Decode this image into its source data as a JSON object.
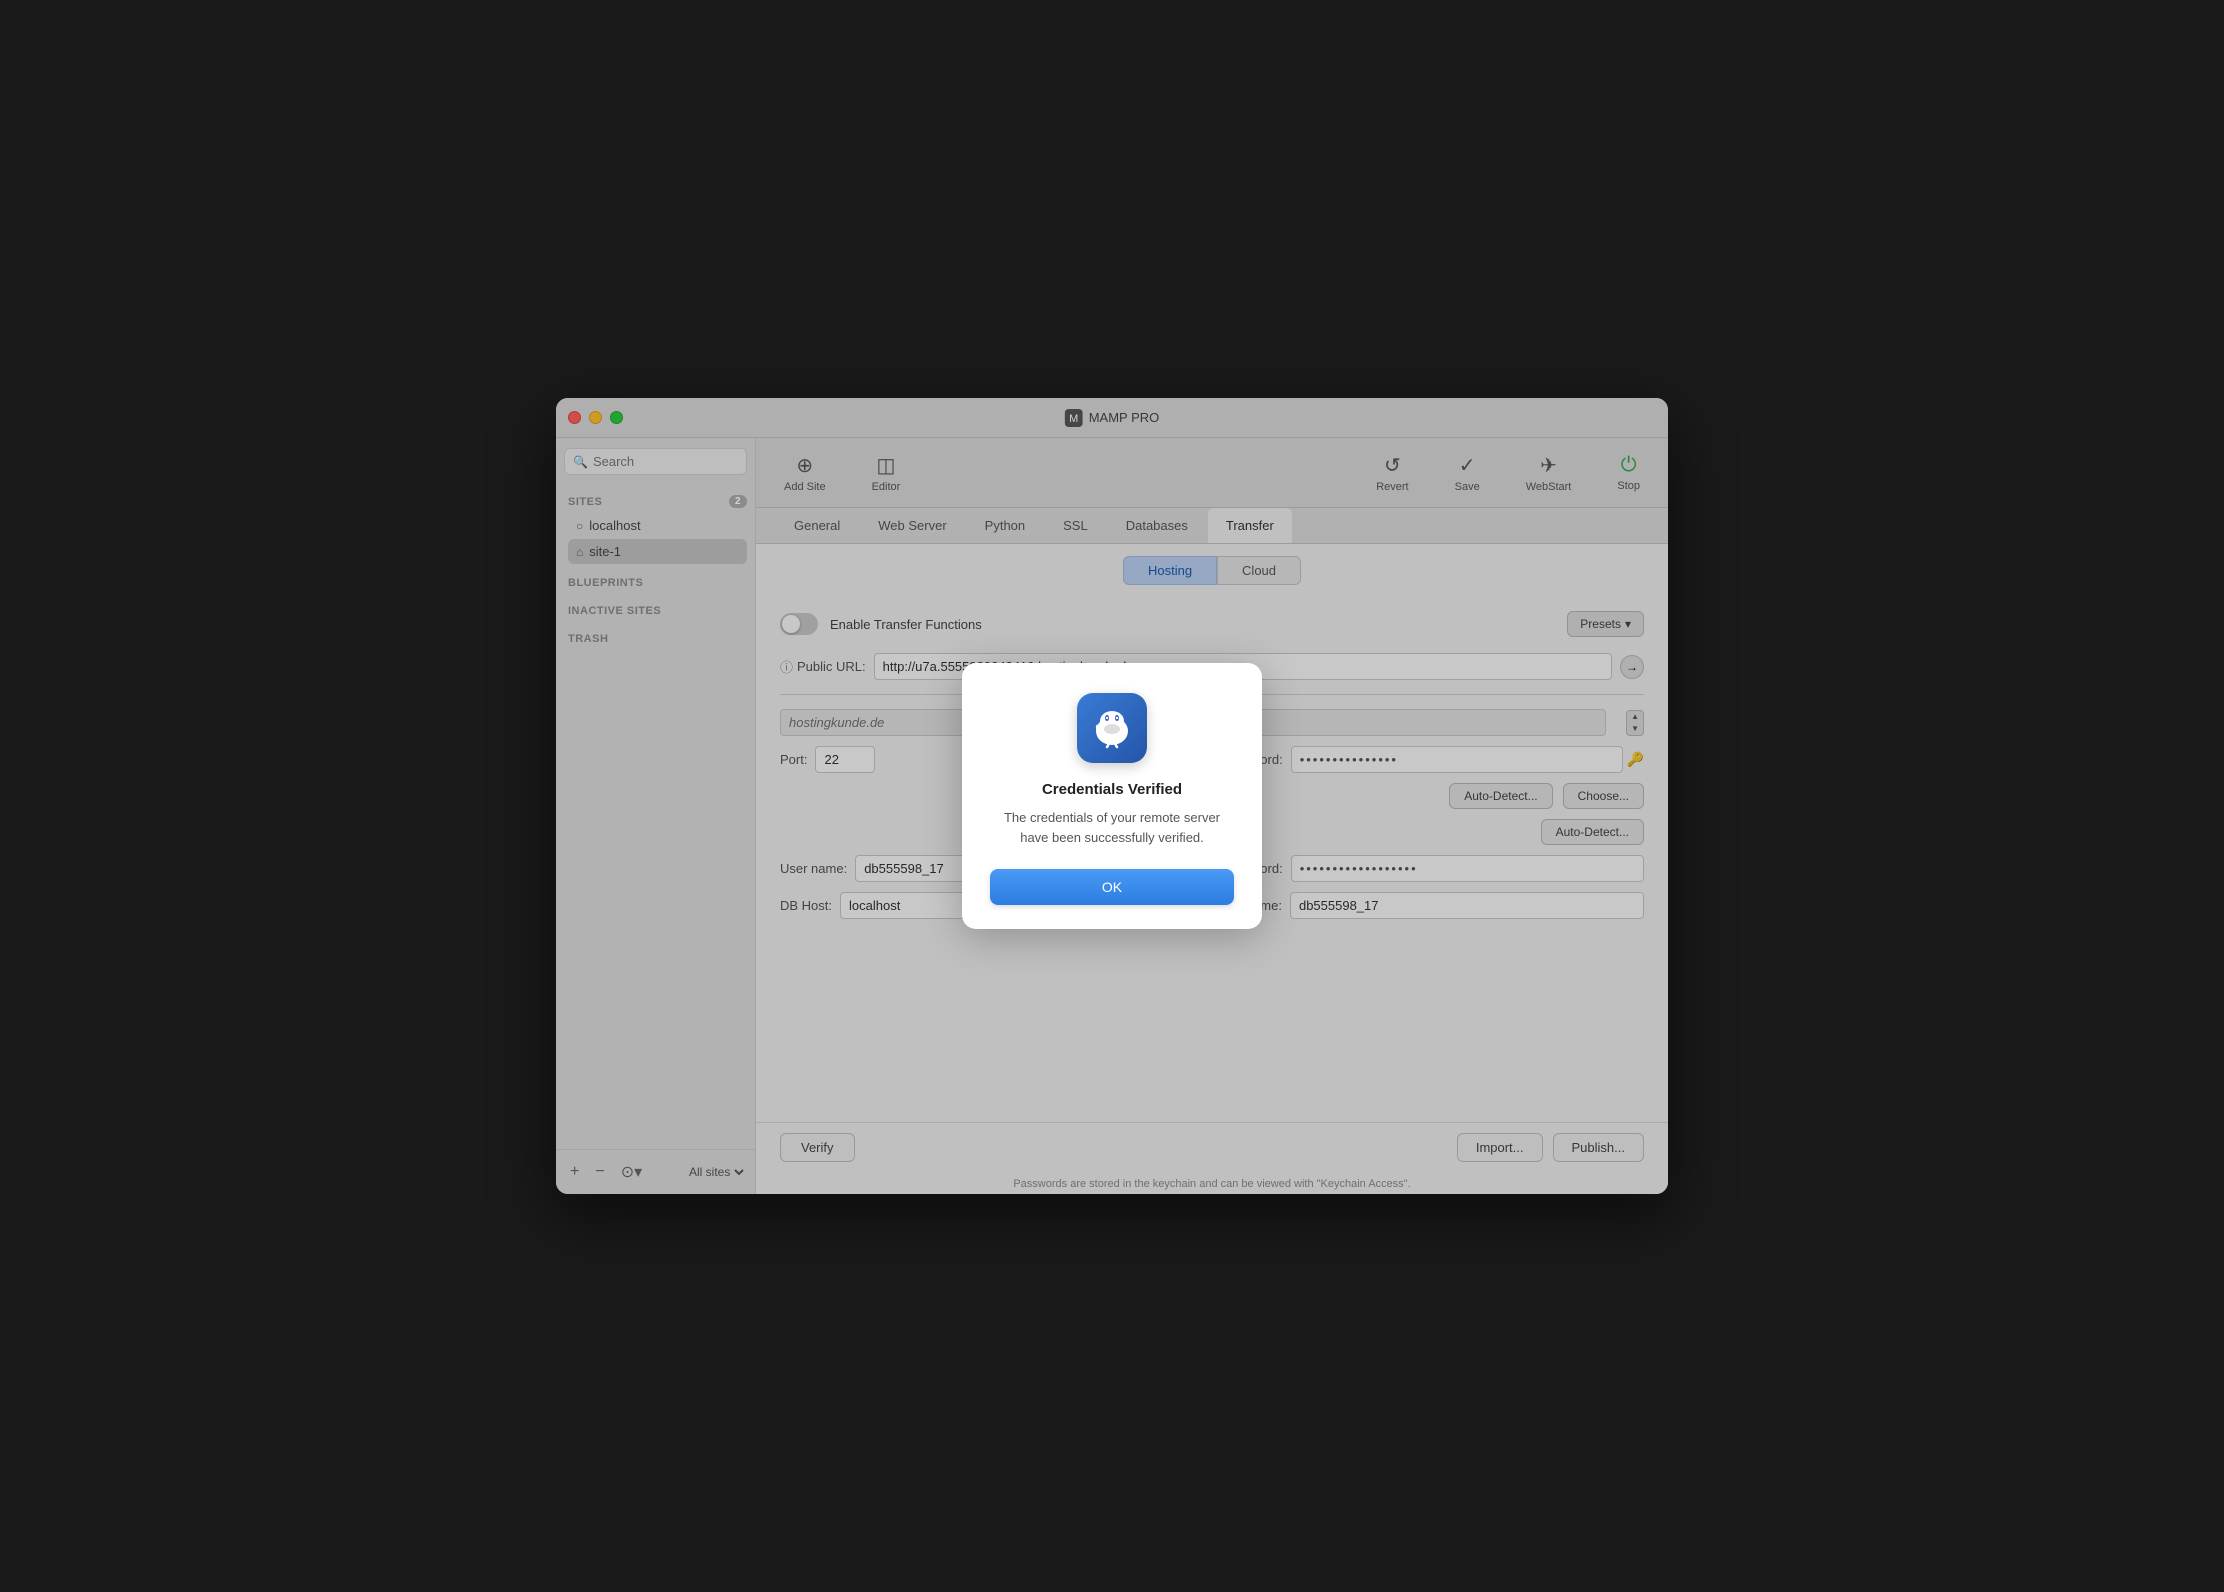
{
  "window": {
    "title": "MAMP PRO"
  },
  "traffic_lights": {
    "close": "close",
    "minimize": "minimize",
    "maximize": "maximize"
  },
  "toolbar": {
    "add_site_label": "Add Site",
    "editor_label": "Editor",
    "revert_label": "Revert",
    "save_label": "Save",
    "webstart_label": "WebStart",
    "stop_label": "Stop"
  },
  "sidebar": {
    "search_placeholder": "Search",
    "sections": [
      {
        "id": "sites",
        "label": "SITES",
        "badge": "2",
        "items": [
          {
            "id": "localhost",
            "label": "localhost",
            "icon": "○",
            "active": false
          },
          {
            "id": "site-1",
            "label": "site-1",
            "icon": "⌂",
            "active": true
          }
        ]
      },
      {
        "id": "blueprints",
        "label": "BLUEPRINTS",
        "items": []
      },
      {
        "id": "inactive-sites",
        "label": "INACTIVE SITES",
        "items": []
      },
      {
        "id": "trash",
        "label": "TRASH",
        "items": []
      }
    ],
    "bottom": {
      "add_label": "+",
      "remove_label": "−",
      "more_label": "⊙",
      "all_sites_label": "All sites"
    }
  },
  "tabs": [
    {
      "id": "general",
      "label": "General"
    },
    {
      "id": "web-server",
      "label": "Web Server"
    },
    {
      "id": "python",
      "label": "Python"
    },
    {
      "id": "ssl",
      "label": "SSL"
    },
    {
      "id": "databases",
      "label": "Databases"
    },
    {
      "id": "transfer",
      "label": "Transfer",
      "active": true
    }
  ],
  "sub_tabs": [
    {
      "id": "hosting",
      "label": "Hosting",
      "active": true
    },
    {
      "id": "cloud",
      "label": "Cloud"
    }
  ],
  "transfer": {
    "enable_label": "Enable Transfer Functions",
    "presets_label": "Presets",
    "public_url_label": "Public URL:",
    "public_url_value": "http://u7a.5555989048419.hostingkunde.de",
    "server_label": "hostingkunde.de",
    "port_label": "Port:",
    "port_value": "22",
    "password_label": "Password:",
    "password_dots": "●●●●●●●●●●●●●●●",
    "auto_detect_label": "Auto-Detect...",
    "choose_label": "Choose...",
    "auto_detect2_label": "Auto-Detect...",
    "username_label": "User name:",
    "username_value": "db555598_17",
    "password2_label": "Password:",
    "password2_dots": "●●●●●●●●●●●●●●●●●●",
    "db_host_label": "DB Host:",
    "db_host_value": "localhost",
    "db_name_label": "DB Name:",
    "db_name_value": "db555598_17",
    "verify_label": "Verify",
    "import_label": "Import...",
    "publish_label": "Publish...",
    "footer_note": "Passwords are stored in the keychain and can be viewed with \"Keychain Access\"."
  },
  "modal": {
    "title": "Credentials Verified",
    "message": "The credentials of your remote server have been successfully verified.",
    "ok_label": "OK"
  }
}
